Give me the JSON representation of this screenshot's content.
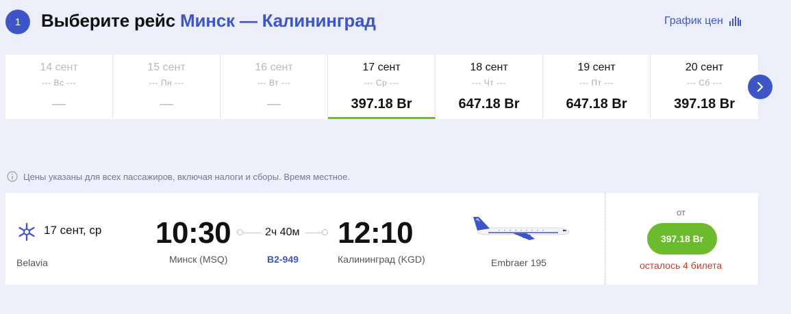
{
  "header": {
    "step": "1",
    "title_prefix": "Выберите рейс",
    "route": "Минск — Калининград",
    "price_chart_label": "График цен"
  },
  "dates": [
    {
      "date": "14 сент",
      "weekday": "--- Вс ---",
      "price": "—",
      "state": "disabled"
    },
    {
      "date": "15 сент",
      "weekday": "--- Пн ---",
      "price": "—",
      "state": "disabled"
    },
    {
      "date": "16 сент",
      "weekday": "--- Вт ---",
      "price": "—",
      "state": "disabled"
    },
    {
      "date": "17 сент",
      "weekday": "--- Ср ---",
      "price": "397.18 Br",
      "state": "selected"
    },
    {
      "date": "18 сент",
      "weekday": "--- Чт ---",
      "price": "647.18 Br",
      "state": "normal"
    },
    {
      "date": "19 сент",
      "weekday": "--- Пт ---",
      "price": "647.18 Br",
      "state": "normal"
    },
    {
      "date": "20 сент",
      "weekday": "--- Сб ---",
      "price": "397.18 Br",
      "state": "normal"
    }
  ],
  "info_text": "Цены указаны для всех пассажиров, включая налоги и сборы. Время местное.",
  "flight": {
    "date": "17 сент, ср",
    "airline": "Belavia",
    "dep_time": "10:30",
    "dep_city": "Минск (MSQ)",
    "duration": "2ч 40м",
    "flight_number": "B2-949",
    "arr_time": "12:10",
    "arr_city": "Калининград (KGD)",
    "aircraft": "Embraer 195",
    "price_prefix": "от",
    "price": "397.18 Br",
    "seats_left": "осталось 4 билета"
  },
  "colors": {
    "accent": "#3d55c5",
    "price_green": "#6cba2d",
    "warning_red": "#c0392b",
    "background": "#eceef9"
  },
  "icons": {
    "step": "step-number-badge",
    "chart": "bar-chart-icon",
    "next": "chevron-right-icon",
    "info": "info-icon",
    "airline": "belavia-logo-icon",
    "aircraft": "airplane-image"
  }
}
